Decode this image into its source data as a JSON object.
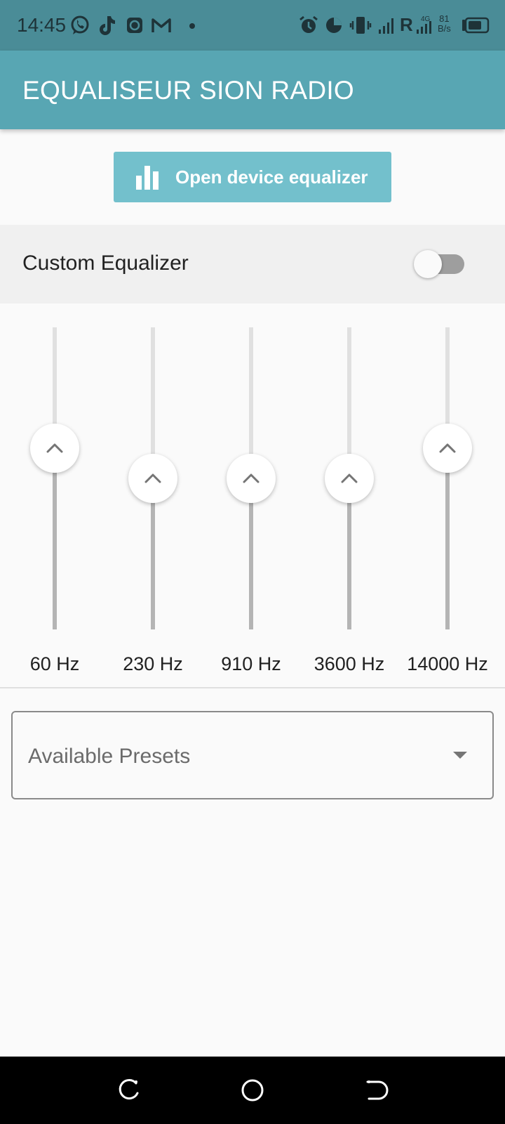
{
  "status_bar": {
    "time": "14:45",
    "network_type": "4G",
    "carrier_indicator": "R",
    "net_speed_value": "81",
    "net_speed_unit": "B/s",
    "icons": [
      "whatsapp-icon",
      "tiktok-icon",
      "app-b-icon",
      "gmail-icon",
      "notification-dot",
      "alarm-icon",
      "data-usage-icon",
      "vibrate-icon",
      "signal-icon",
      "signal-4g-icon",
      "battery-icon"
    ]
  },
  "app_bar": {
    "title": "EQUALISEUR SION RADIO"
  },
  "open_eq_button": {
    "label": "Open device equalizer",
    "icon": "equalizer-bars-icon"
  },
  "custom_equalizer": {
    "label": "Custom Equalizer",
    "enabled": false
  },
  "bands": [
    {
      "label": "60 Hz",
      "level": 0.6
    },
    {
      "label": "230 Hz",
      "level": 0.5
    },
    {
      "label": "910 Hz",
      "level": 0.5
    },
    {
      "label": "3600 Hz",
      "level": 0.5
    },
    {
      "label": "14000 Hz",
      "level": 0.6
    }
  ],
  "presets": {
    "placeholder": "Available Presets"
  },
  "nav_bar": {
    "buttons": [
      "recents-icon",
      "home-icon",
      "back-icon"
    ]
  },
  "colors": {
    "status_bar": "#4a8c97",
    "app_bar": "#58a6b3",
    "button": "#73c0cc",
    "track_active": "#b4b4b4",
    "track_inactive": "#e0e0e0"
  }
}
